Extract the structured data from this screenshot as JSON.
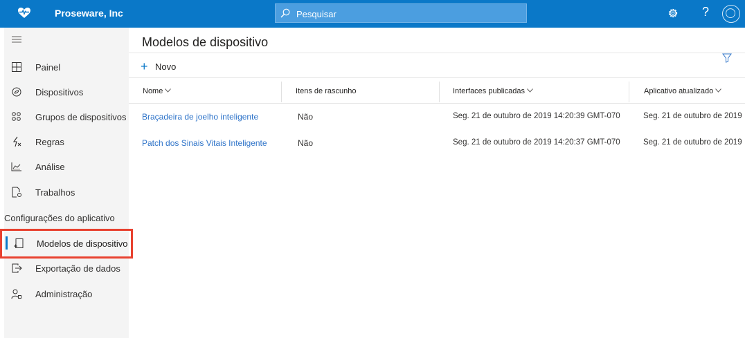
{
  "app": {
    "brand": "Proseware, Inc",
    "icons": [
      "heart-pulse-icon",
      "search-icon",
      "gear-icon",
      "help-icon",
      "avatar"
    ],
    "accent": "#0a78c8"
  },
  "search": {
    "placeholder": "Pesquisar"
  },
  "header": {
    "help": "?"
  },
  "sidebar": {
    "items": [
      {
        "label": "Painel",
        "icon": "dashboard-icon"
      },
      {
        "label": "Dispositivos",
        "icon": "devices-icon"
      },
      {
        "label": "Grupos de dispositivos",
        "icon": "device-groups-icon"
      },
      {
        "label": "Regras",
        "icon": "rules-icon"
      },
      {
        "label": "Análise",
        "icon": "analytics-icon"
      },
      {
        "label": "Trabalhos",
        "icon": "jobs-icon"
      }
    ],
    "section_title": "Configurações do aplicativo",
    "settings_items": [
      {
        "label": "Modelos de dispositivo",
        "icon": "device-templates-icon",
        "active": true
      },
      {
        "label": "Exportação de dados",
        "icon": "data-export-icon"
      },
      {
        "label": "Administração",
        "icon": "administration-icon"
      }
    ]
  },
  "main": {
    "title": "Modelos de dispositivo",
    "new_label": "Novo",
    "columns": [
      "Nome",
      "Itens de rascunho",
      "Interfaces publicadas",
      "Aplicativo atualizado"
    ],
    "rows": [
      [
        "Braçadeira de joelho inteligente",
        "Não",
        "Seg. 21 de outubro de 2019 14:20:39 GMT-070",
        "Seg. 21 de outubro de 2019"
      ],
      [
        "Patch dos Sinais Vitais Inteligente",
        "Não",
        "Seg. 21 de outubro de 2019 14:20:37 GMT-070",
        "Seg. 21 de outubro de 2019"
      ]
    ]
  }
}
